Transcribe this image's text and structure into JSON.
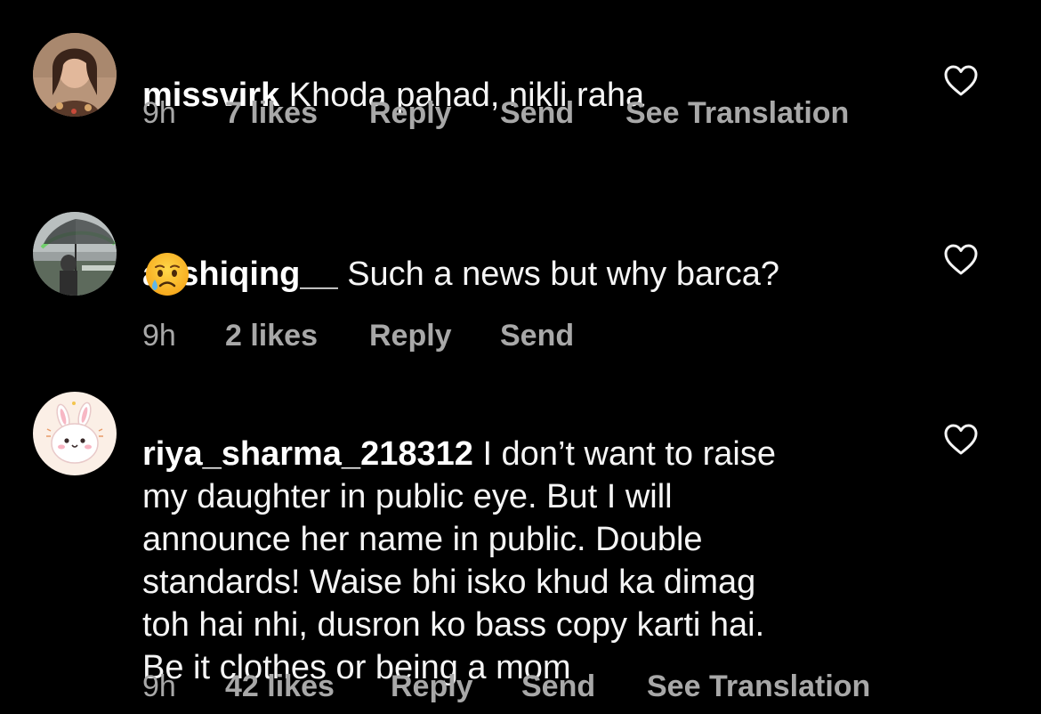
{
  "colors": {
    "background": "#000000",
    "text": "#ffffff",
    "meta_text": "#a8a8a8"
  },
  "comments": [
    {
      "username": "missvirk",
      "text": "Khoda pahad, nikli raha",
      "time": "9h",
      "likes": "7 likes",
      "reply": "Reply",
      "send": "Send",
      "translation": "See Translation",
      "like_icon": "heart-outline-icon"
    },
    {
      "username": "aashiqing__",
      "text": "Such a news but why barca?",
      "emoji": "crying-face-emoji",
      "time": "9h",
      "likes": "2 likes",
      "reply": "Reply",
      "send": "Send",
      "like_icon": "heart-outline-icon"
    },
    {
      "username": "riya_sharma_218312",
      "text": "I don’t want to raise\nmy daughter in public eye. But I will\nannounce her name in public. Double\nstandards! Waise bhi isko khud ka dimag\ntoh hai nhi, dusron ko bass copy karti hai.\nBe it clothes or being a mom",
      "time": "9h",
      "likes": "42 likes",
      "reply": "Reply",
      "send": "Send",
      "translation": "See Translation",
      "like_icon": "heart-outline-icon"
    }
  ]
}
